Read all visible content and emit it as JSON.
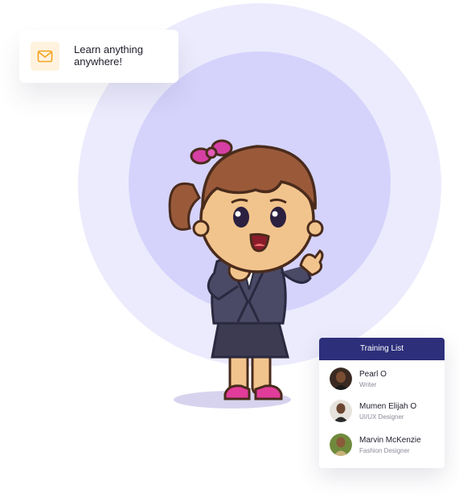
{
  "notice": {
    "icon": "mail-icon",
    "text": "Learn anything anywhere!"
  },
  "illustration": {
    "subject": "cartoon-girl-in-suit"
  },
  "training_list": {
    "title": "Training List",
    "people": [
      {
        "name": "Pearl O",
        "role": "Writer"
      },
      {
        "name": "Mumen Elijah O",
        "role": "UI/UX Designer"
      },
      {
        "name": "Marvin McKenzie",
        "role": "Fashion Designer"
      }
    ]
  },
  "colors": {
    "outer_circle": "#ecebfd",
    "inner_circle": "#d5d3fb",
    "header": "#2d2f7a",
    "icon_bg": "#fff3df",
    "icon": "#f4a21f"
  }
}
